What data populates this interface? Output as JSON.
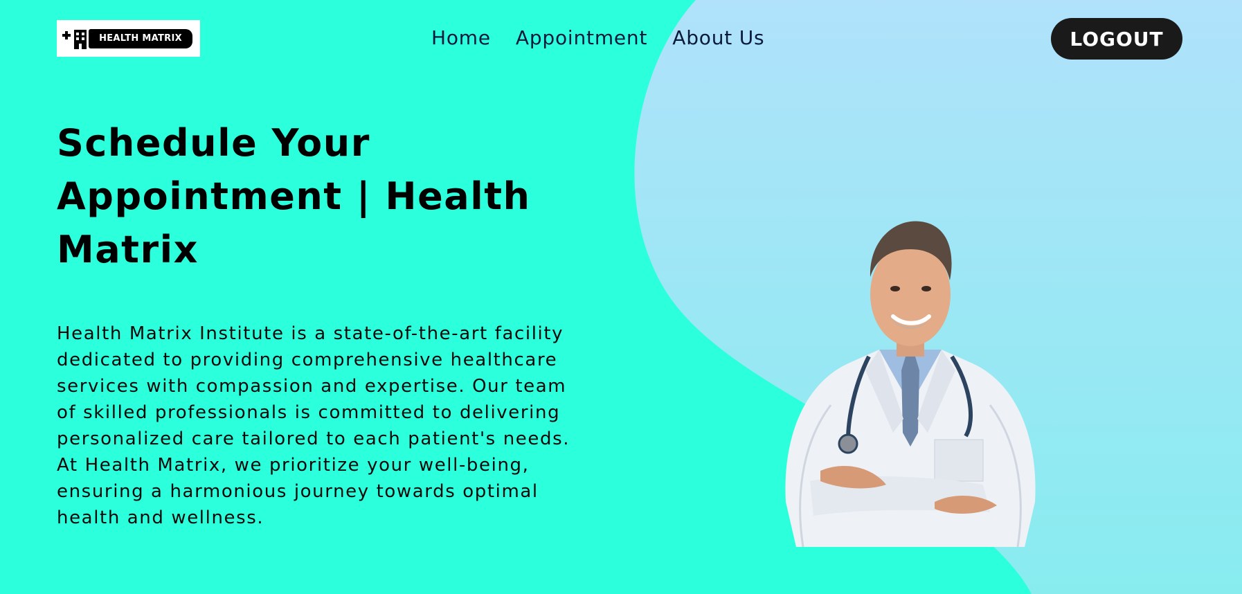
{
  "brand": {
    "logo_text": "HEALTH MATRIX"
  },
  "nav": {
    "items": [
      {
        "label": "Home"
      },
      {
        "label": "Appointment"
      },
      {
        "label": "About Us"
      }
    ]
  },
  "header": {
    "logout_label": "LOGOUT"
  },
  "hero": {
    "title": "Schedule Your Appointment | Health Matrix",
    "description": "Health Matrix Institute is a state-of-the-art facility dedicated to providing comprehensive healthcare services with compassion and expertise. Our team of skilled professionals is committed to delivering personalized care tailored to each patient's needs. At Health Matrix, we prioritize your well-being, ensuring a harmonious journey towards optimal health and wellness."
  },
  "colors": {
    "background": "#2cffdc",
    "blob_top": "#b0e2fb",
    "blob_bottom": "#88ecef",
    "logout_bg": "#1a1a1a"
  },
  "icons": {
    "logo": "hospital-plus-icon",
    "hero_image": "doctor-illustration"
  }
}
